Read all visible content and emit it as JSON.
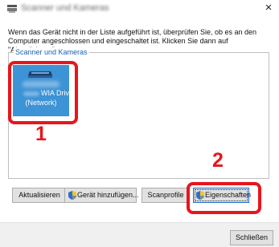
{
  "window": {
    "title": "Scanner und Kameras",
    "close_glyph": "×"
  },
  "instruction": "Wenn das Gerät nicht in der Liste aufgeführt ist, überprüfen Sie, ob es an den Computer angeschlossen und eingeschaltet ist. Klicken Sie dann auf \"Aktualisieren\".",
  "device_group": {
    "legend": "Scanner und Kameras",
    "devices": [
      {
        "label_line1": "WIA Driver",
        "label_line2": "(Network)",
        "selected": true,
        "icon": "scanner-icon"
      }
    ]
  },
  "callouts": [
    {
      "number": "1",
      "color": "#e8151b"
    },
    {
      "number": "2",
      "color": "#e8151b"
    }
  ],
  "buttons": {
    "refresh": "Aktualisieren",
    "add_device": "Gerät hinzufügen...",
    "scan_profiles": "Scanprofile",
    "properties": "Eigenschaften",
    "close": "Schließen"
  },
  "colors": {
    "selection": "#3c93d6",
    "accent_text": "#1a5fb4",
    "callout": "#e8151b"
  }
}
